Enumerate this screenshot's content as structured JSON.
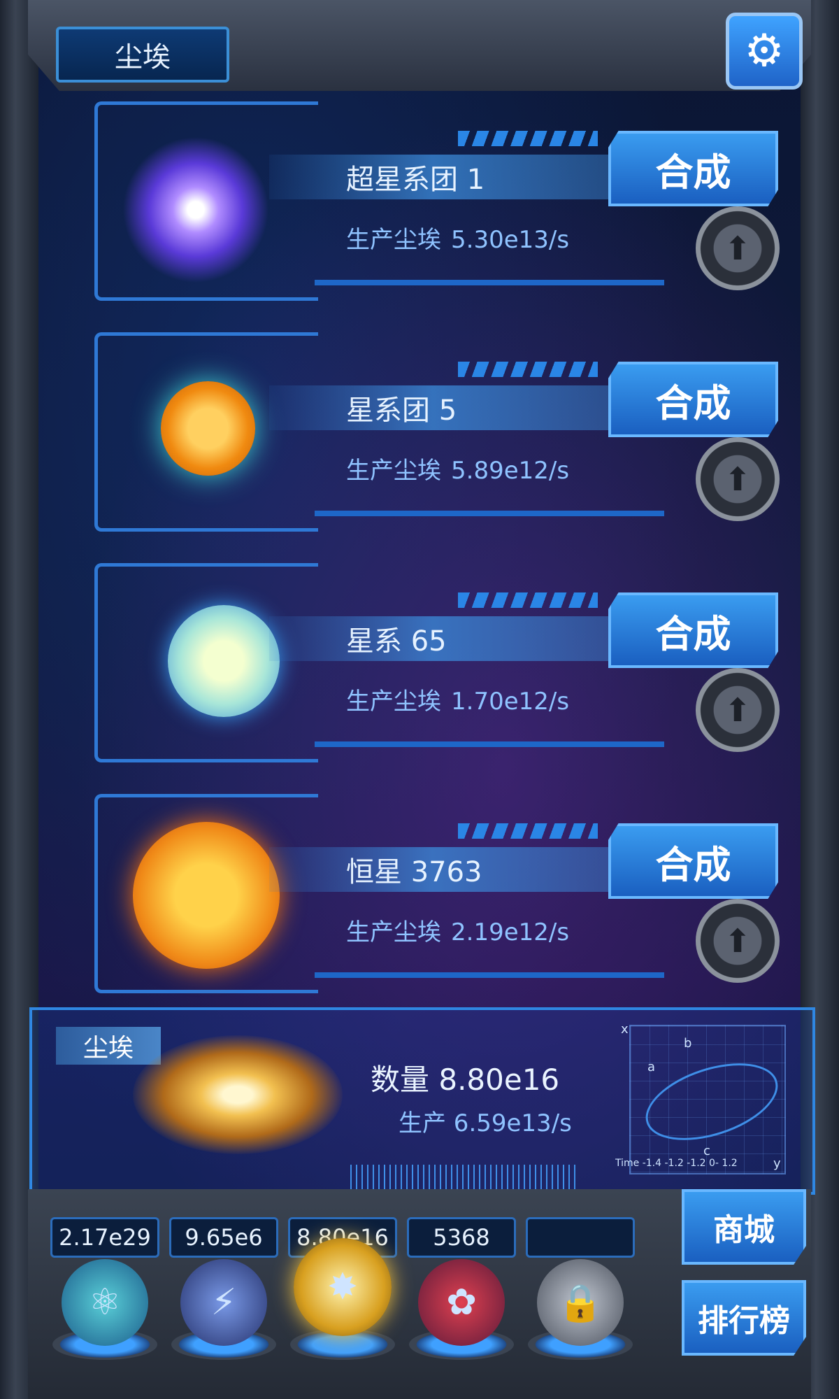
{
  "header": {
    "title": "尘埃",
    "settings_icon": "gear-icon"
  },
  "cards": [
    {
      "name": "超星系团 1",
      "prod_label": "生产尘埃",
      "prod_value": "5.30e13/s",
      "merge_label": "合成",
      "color": "#9a6bff"
    },
    {
      "name": "星系团 5",
      "prod_label": "生产尘埃",
      "prod_value": "5.89e12/s",
      "merge_label": "合成",
      "color": "#f0a020"
    },
    {
      "name": "星系 65",
      "prod_label": "生产尘埃",
      "prod_value": "1.70e12/s",
      "merge_label": "合成",
      "color": "#9fe0e6"
    },
    {
      "name": "恒星 3763",
      "prod_label": "生产尘埃",
      "prod_value": "2.19e12/s",
      "merge_label": "合成",
      "color": "#f08a18"
    }
  ],
  "dust": {
    "label": "尘埃",
    "quantity": "数量 8.80e16",
    "production": "生产 6.59e13/s",
    "graph_labels": [
      "a",
      "b",
      "c",
      "Time -1.4 -1.2 -1.2 0- 1.2",
      "y",
      "x"
    ]
  },
  "resources": [
    {
      "value": "2.17e29",
      "icon": "atom-icon"
    },
    {
      "value": "9.65e6",
      "icon": "lightning-icon"
    },
    {
      "value": "8.80e16",
      "icon": "dust-icon"
    },
    {
      "value": "5368",
      "icon": "brain-icon"
    },
    {
      "value": "",
      "icon": "lock-icon"
    }
  ],
  "side_buttons": {
    "shop": "商城",
    "ranking": "排行榜"
  }
}
